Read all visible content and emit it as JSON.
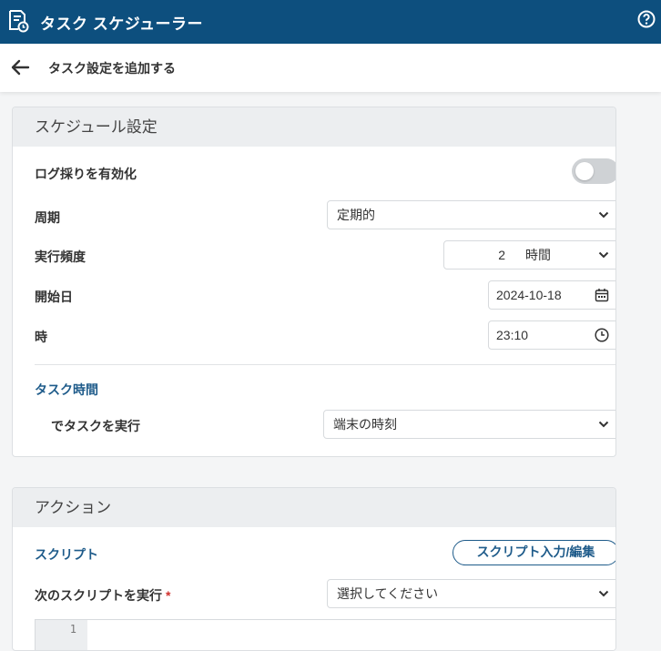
{
  "app": {
    "title": "タスク スケジューラー"
  },
  "header": {
    "subtitle": "タスク設定を追加する"
  },
  "schedule": {
    "section_title": "スケジュール設定",
    "logging": {
      "label": "ログ採りを有効化",
      "enabled": false
    },
    "period": {
      "label": "周期",
      "value": "定期的"
    },
    "frequency": {
      "label": "実行頻度",
      "value": "2",
      "unit": "時間"
    },
    "start_date": {
      "label": "開始日",
      "value": "2024-10-18"
    },
    "time": {
      "label": "時",
      "value": "23:10"
    },
    "task_time": {
      "section_label": "タスク時間",
      "run_label": "でタスクを実行",
      "value": "端末の時刻"
    }
  },
  "action": {
    "section_title": "アクション",
    "script_label": "スクリプト",
    "script_button": "スクリプト入力/編集",
    "run_script": {
      "label": "次のスクリプトを実行",
      "required_mark": "*",
      "placeholder": "選択してください"
    },
    "editor": {
      "line_number": "1"
    }
  },
  "colors": {
    "appbar": "#0d4f7e",
    "accent": "#1e5b8a",
    "required": "#d0312d"
  }
}
